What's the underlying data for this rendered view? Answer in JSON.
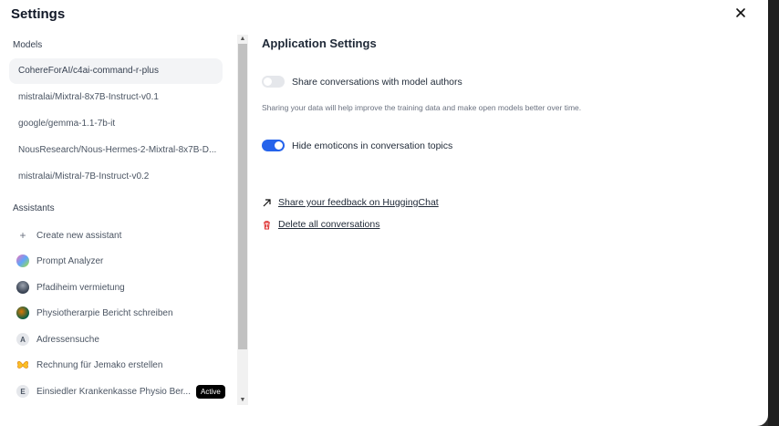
{
  "title": "Settings",
  "sidebar": {
    "models_heading": "Models",
    "models": [
      {
        "label": "CohereForAI/c4ai-command-r-plus",
        "active": true
      },
      {
        "label": "mistralai/Mixtral-8x7B-Instruct-v0.1"
      },
      {
        "label": "google/gemma-1.1-7b-it"
      },
      {
        "label": "NousResearch/Nous-Hermes-2-Mixtral-8x7B-D..."
      },
      {
        "label": "mistralai/Mistral-7B-Instruct-v0.2"
      }
    ],
    "assistants_heading": "Assistants",
    "create_label": "Create new assistant",
    "assistants": [
      {
        "label": "Prompt Analyzer",
        "avatar": "gradient-blob"
      },
      {
        "label": "Pfadiheim vermietung",
        "avatar": "photo"
      },
      {
        "label": "Physiotherarpie Bericht schreiben",
        "avatar": "photo"
      },
      {
        "label": "Adressensuche",
        "avatar_letter": "A"
      },
      {
        "label": "Rechnung für Jemako erstellen",
        "avatar": "butterfly"
      },
      {
        "label": "Einsiedler Krankenkasse Physio Ber...",
        "avatar_letter": "E",
        "badge": "Active"
      }
    ]
  },
  "main": {
    "heading": "Application Settings",
    "share_toggle": {
      "label": "Share conversations with model authors",
      "on": false
    },
    "share_help": "Sharing your data will help improve the training data and make open models better over time.",
    "emoticons_toggle": {
      "label": "Hide emoticons in conversation topics",
      "on": true
    },
    "feedback_link": "Share your feedback on HuggingChat",
    "delete_link": "Delete all conversations"
  },
  "colors": {
    "accent": "#2563eb",
    "danger": "#dc2626"
  }
}
